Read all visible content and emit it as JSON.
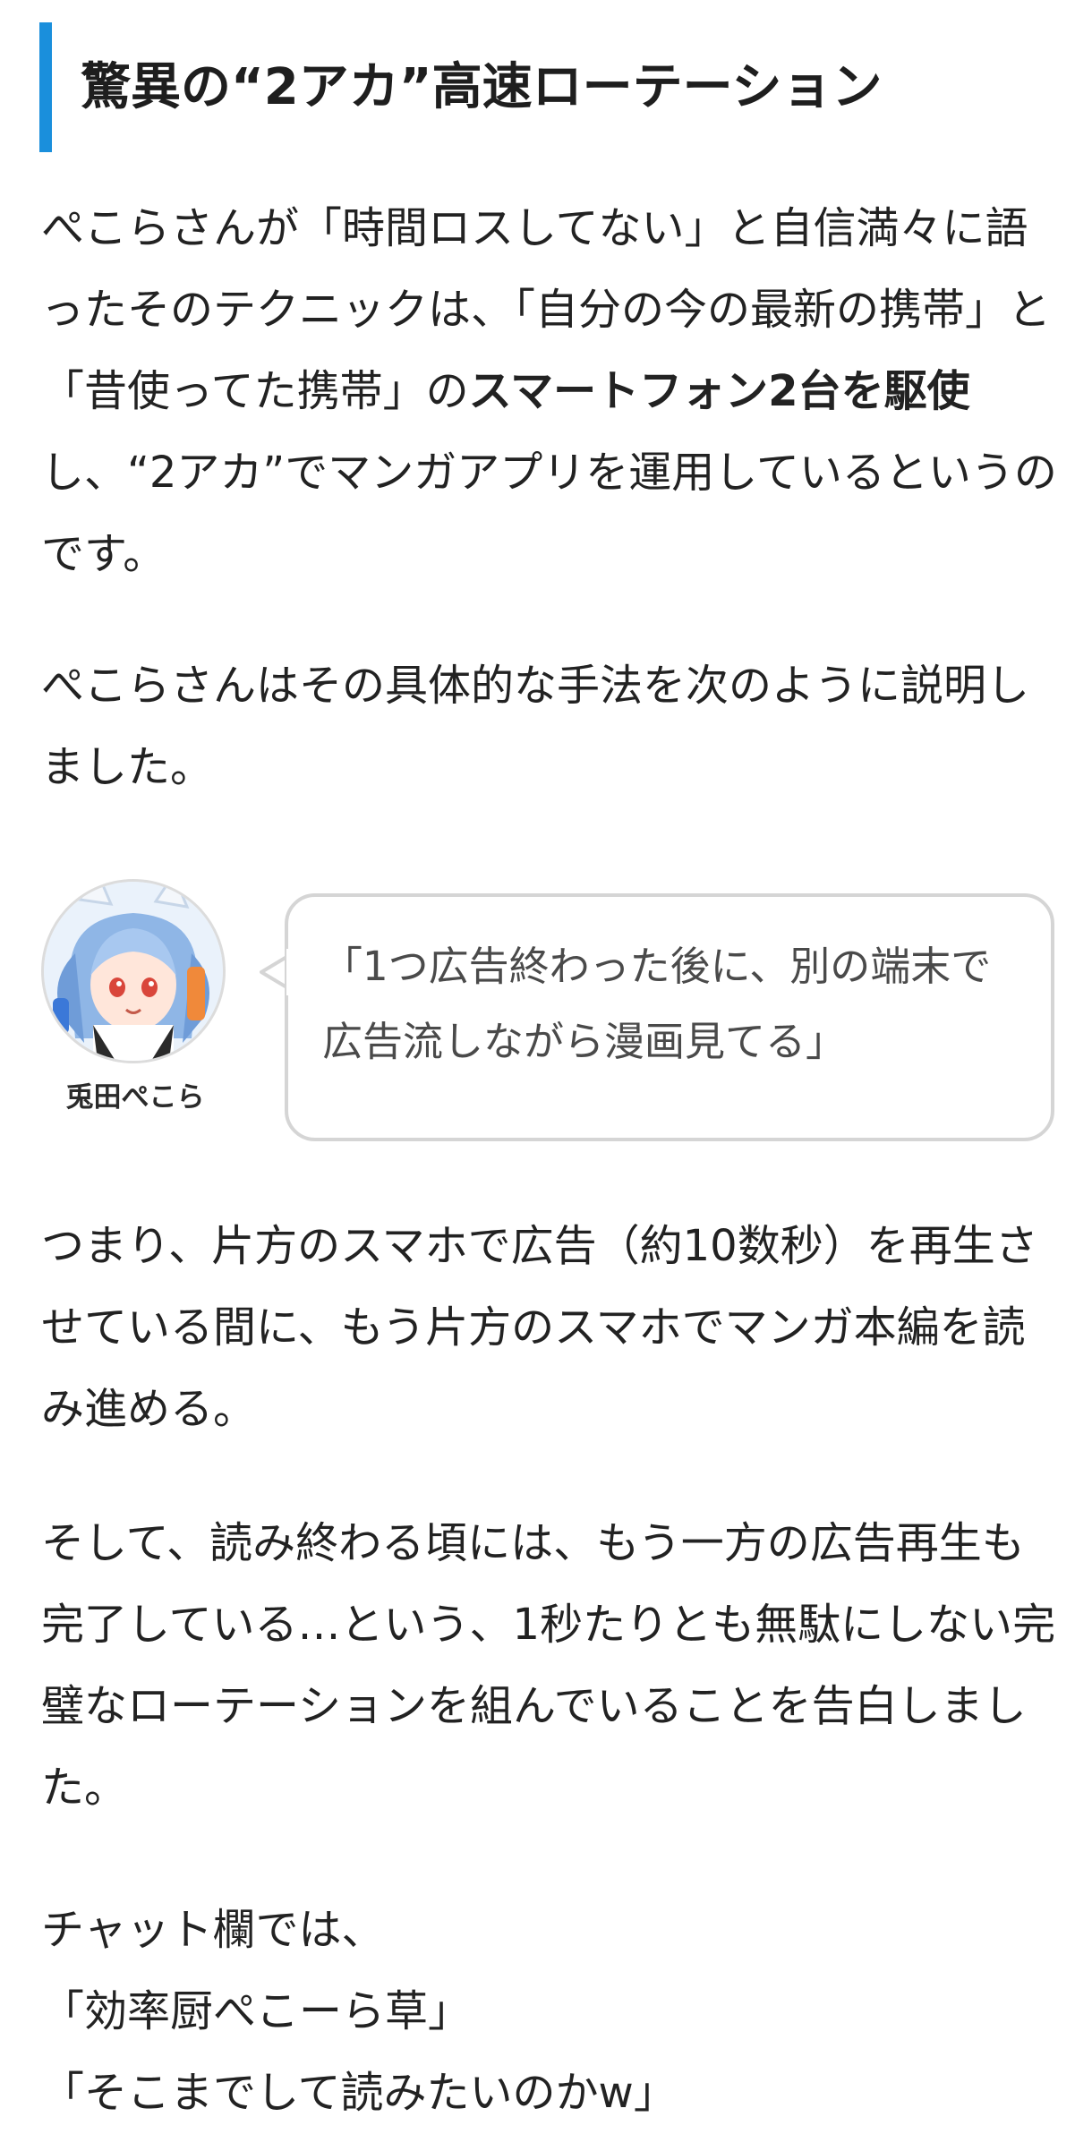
{
  "heading": {
    "title": "驚異の“2アカ”高速ローテーション"
  },
  "paragraphs": {
    "p1": {
      "line1": "ぺこらさんが「時間ロスしてない」と自信満々に語",
      "line2": "ったそのテクニックは、「自分の今の最新の携帯」と",
      "line3_plain": "「昔使ってた携帯」の",
      "line3_bold": "スマートフォン2台を駆使",
      "line4": "し、“2アカ”でマンガアプリを運用しているというの",
      "line5": "です。"
    },
    "p2": {
      "line1": "ぺこらさんはその具体的な手法を次のように説明し",
      "line2": "ました。"
    },
    "quote": {
      "speaker_name": "兎田ぺこら",
      "line1": "「1つ広告終わった後に、別の端末で",
      "line2": "広告流しながら漫画見てる」",
      "border_color": "#d5d5d5"
    },
    "p3": {
      "line1": "つまり、片方のスマホで広告（約10数秒）を再生さ",
      "line2": "せている間に、もう片方のスマホでマンガ本編を読",
      "line3": "み進める。"
    },
    "p4": {
      "line1": "そして、読み終わる頃には、もう一方の広告再生も",
      "line2": "完了している…という、1秒たりとも無駄にしない完",
      "line3": "璧なローテーションを組んでいることを告白しまし",
      "line4": "た。"
    },
    "p5": {
      "line1": "チャット欄では、",
      "line2": "「効率厨ぺこーら草」",
      "line3": "「そこまでして読みたいのかw」"
    }
  },
  "colors": {
    "accent": "#1a8fdc",
    "text": "#222222"
  },
  "icons": {
    "avatar": "character-avatar",
    "bubble_tail": "speech-bubble-tail"
  }
}
